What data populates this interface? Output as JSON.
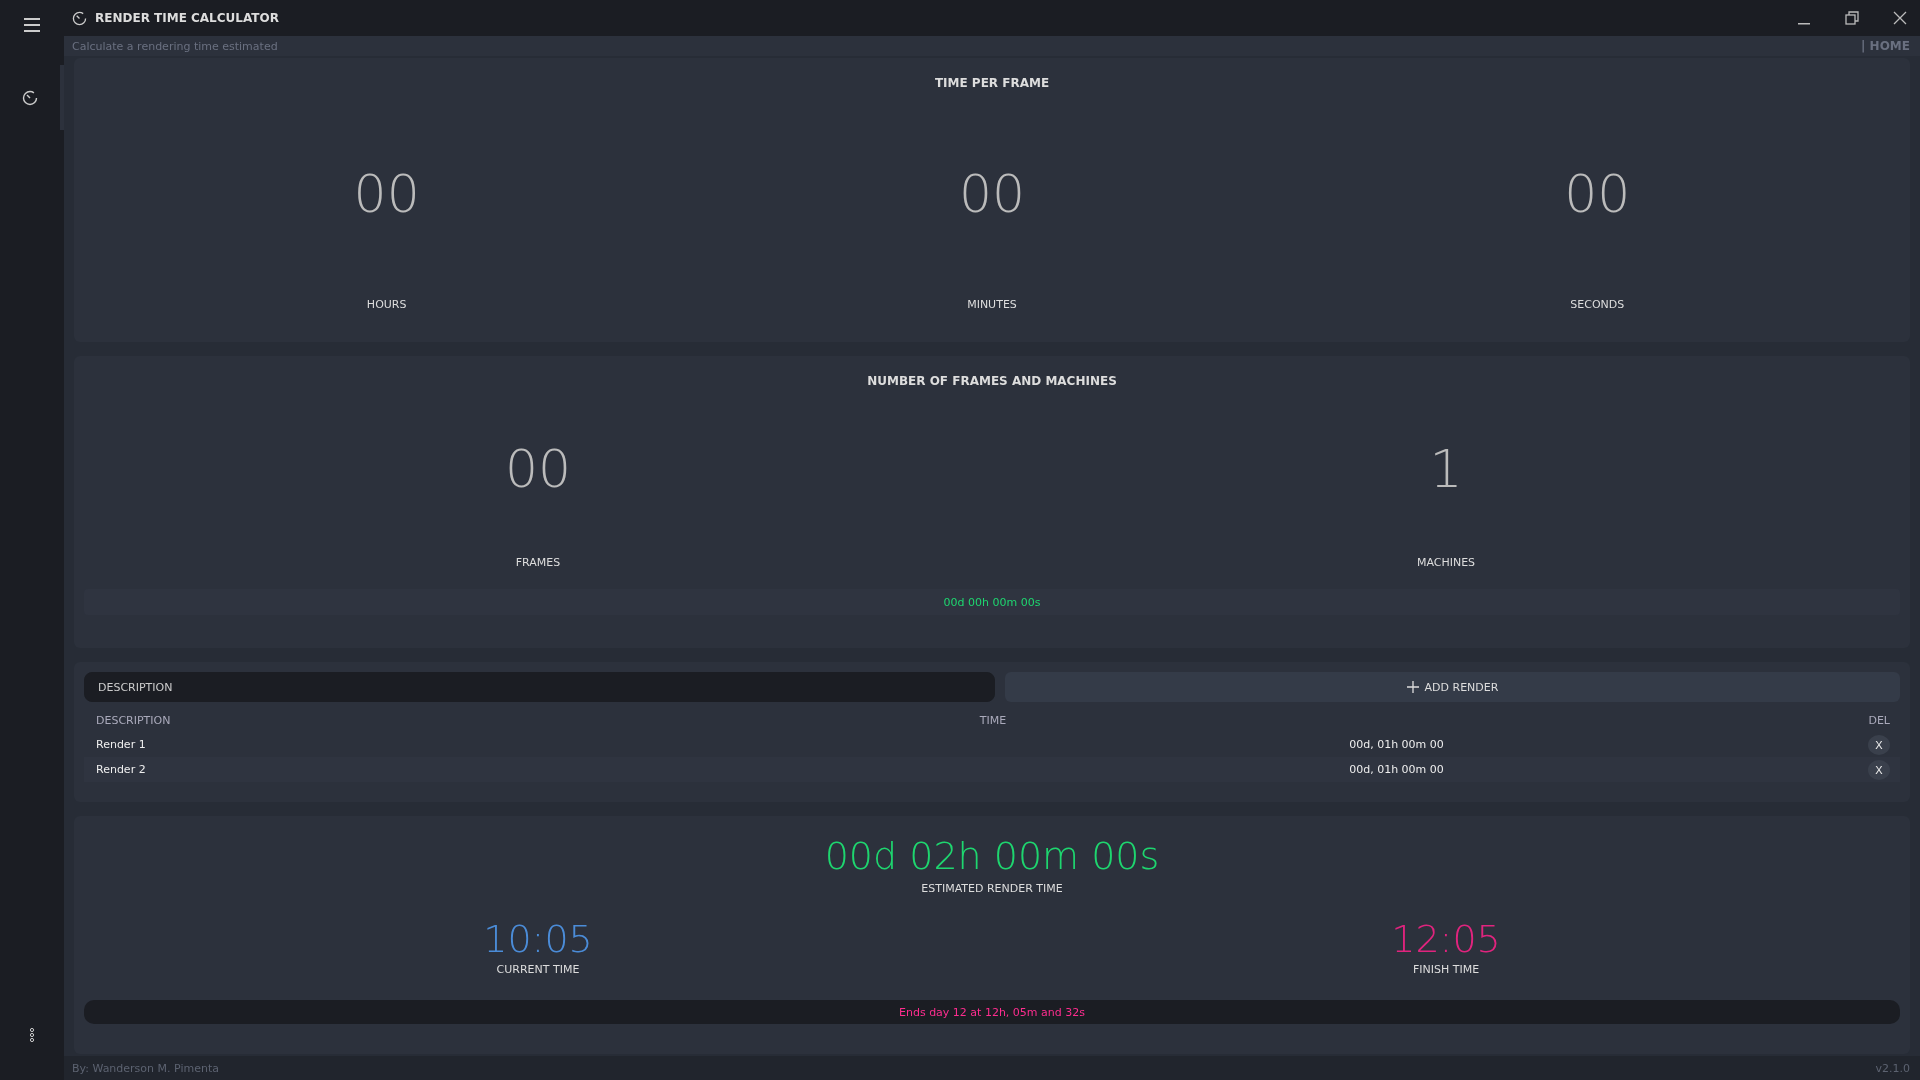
{
  "window": {
    "title": "RENDER TIME CALCULATOR",
    "subtitle": "Calculate a rendering time estimated",
    "breadcrumb": "| HOME"
  },
  "time_per_frame": {
    "title": "TIME PER FRAME",
    "fields": [
      {
        "value": "00",
        "label": "HOURS"
      },
      {
        "value": "00",
        "label": "MINUTES"
      },
      {
        "value": "00",
        "label": "SECONDS"
      }
    ]
  },
  "frames_machines": {
    "title": "NUMBER OF FRAMES AND MACHINES",
    "fields": [
      {
        "value": "00",
        "label": "FRAMES"
      },
      {
        "value": "1",
        "label": "MACHINES"
      }
    ],
    "total": "00d 00h 00m 00s"
  },
  "render_list": {
    "placeholder": "DESCRIPTION",
    "add_button": "ADD RENDER",
    "columns": [
      "DESCRIPTION",
      "TIME",
      "DEL"
    ],
    "rows": [
      {
        "description": "Render 1",
        "time": "00d, 01h 00m 00",
        "delete": "X"
      },
      {
        "description": "Render 2",
        "time": "00d, 01h 00m 00",
        "delete": "X"
      }
    ]
  },
  "result": {
    "estimated": "00d 02h 00m 00s",
    "estimated_label": "ESTIMATED RENDER TIME",
    "current_time": "10:05",
    "current_label": "CURRENT TIME",
    "finish_time": "12:05",
    "finish_label": "FINISH TIME",
    "ends": "Ends day 12 at 12h, 05m and 32s"
  },
  "footer": {
    "author": "By: Wanderson M. Pimenta",
    "version": "v2.1.0"
  }
}
